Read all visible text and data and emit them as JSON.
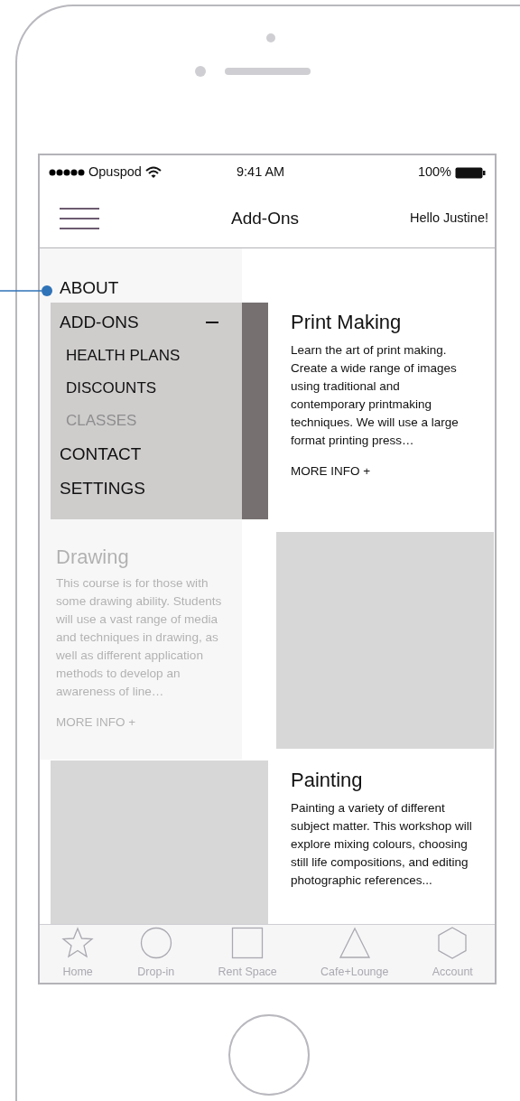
{
  "status_bar": {
    "carrier": "Opuspod",
    "time": "9:41 AM",
    "battery": "100%"
  },
  "header": {
    "title": "Add-Ons",
    "greeting": "Hello Justine!"
  },
  "courses": [
    {
      "kind": "image-left",
      "title": "Print Making",
      "description": "Learn the art of print making. Create a wide range of images using traditional and contemporary printmaking techniques. We will use a large format printing press…",
      "link": "MORE INFO +",
      "color": "#767170"
    },
    {
      "kind": "text-left",
      "title": "Drawing",
      "description": "This course is for those with some drawing ability. Students will use a vast range of media and techniques in drawing, as well as different application methods to develop an awareness of line…",
      "link": "MORE INFO +",
      "color": "#d8d7d8"
    },
    {
      "kind": "image-left",
      "title": "Painting",
      "description": "Painting a variety of different subject matter. This workshop will explore mixing colours, choosing still life compositions, and editing photographic references...",
      "color": "#d8d7d8"
    }
  ],
  "menu": [
    {
      "label": "ABOUT",
      "expanded": false
    },
    {
      "label": "ADD-ONS",
      "expanded": true,
      "children": [
        {
          "label": "HEALTH PLANS",
          "disabled": false
        },
        {
          "label": "DISCOUNTS",
          "disabled": false
        },
        {
          "label": "CLASSES",
          "disabled": true
        }
      ]
    },
    {
      "label": "CONTACT",
      "expanded": false
    },
    {
      "label": "SETTINGS",
      "expanded": false
    }
  ],
  "tabs": [
    "Home",
    "Drop-in",
    "Rent Space",
    "Cafe+Lounge",
    "Account"
  ]
}
